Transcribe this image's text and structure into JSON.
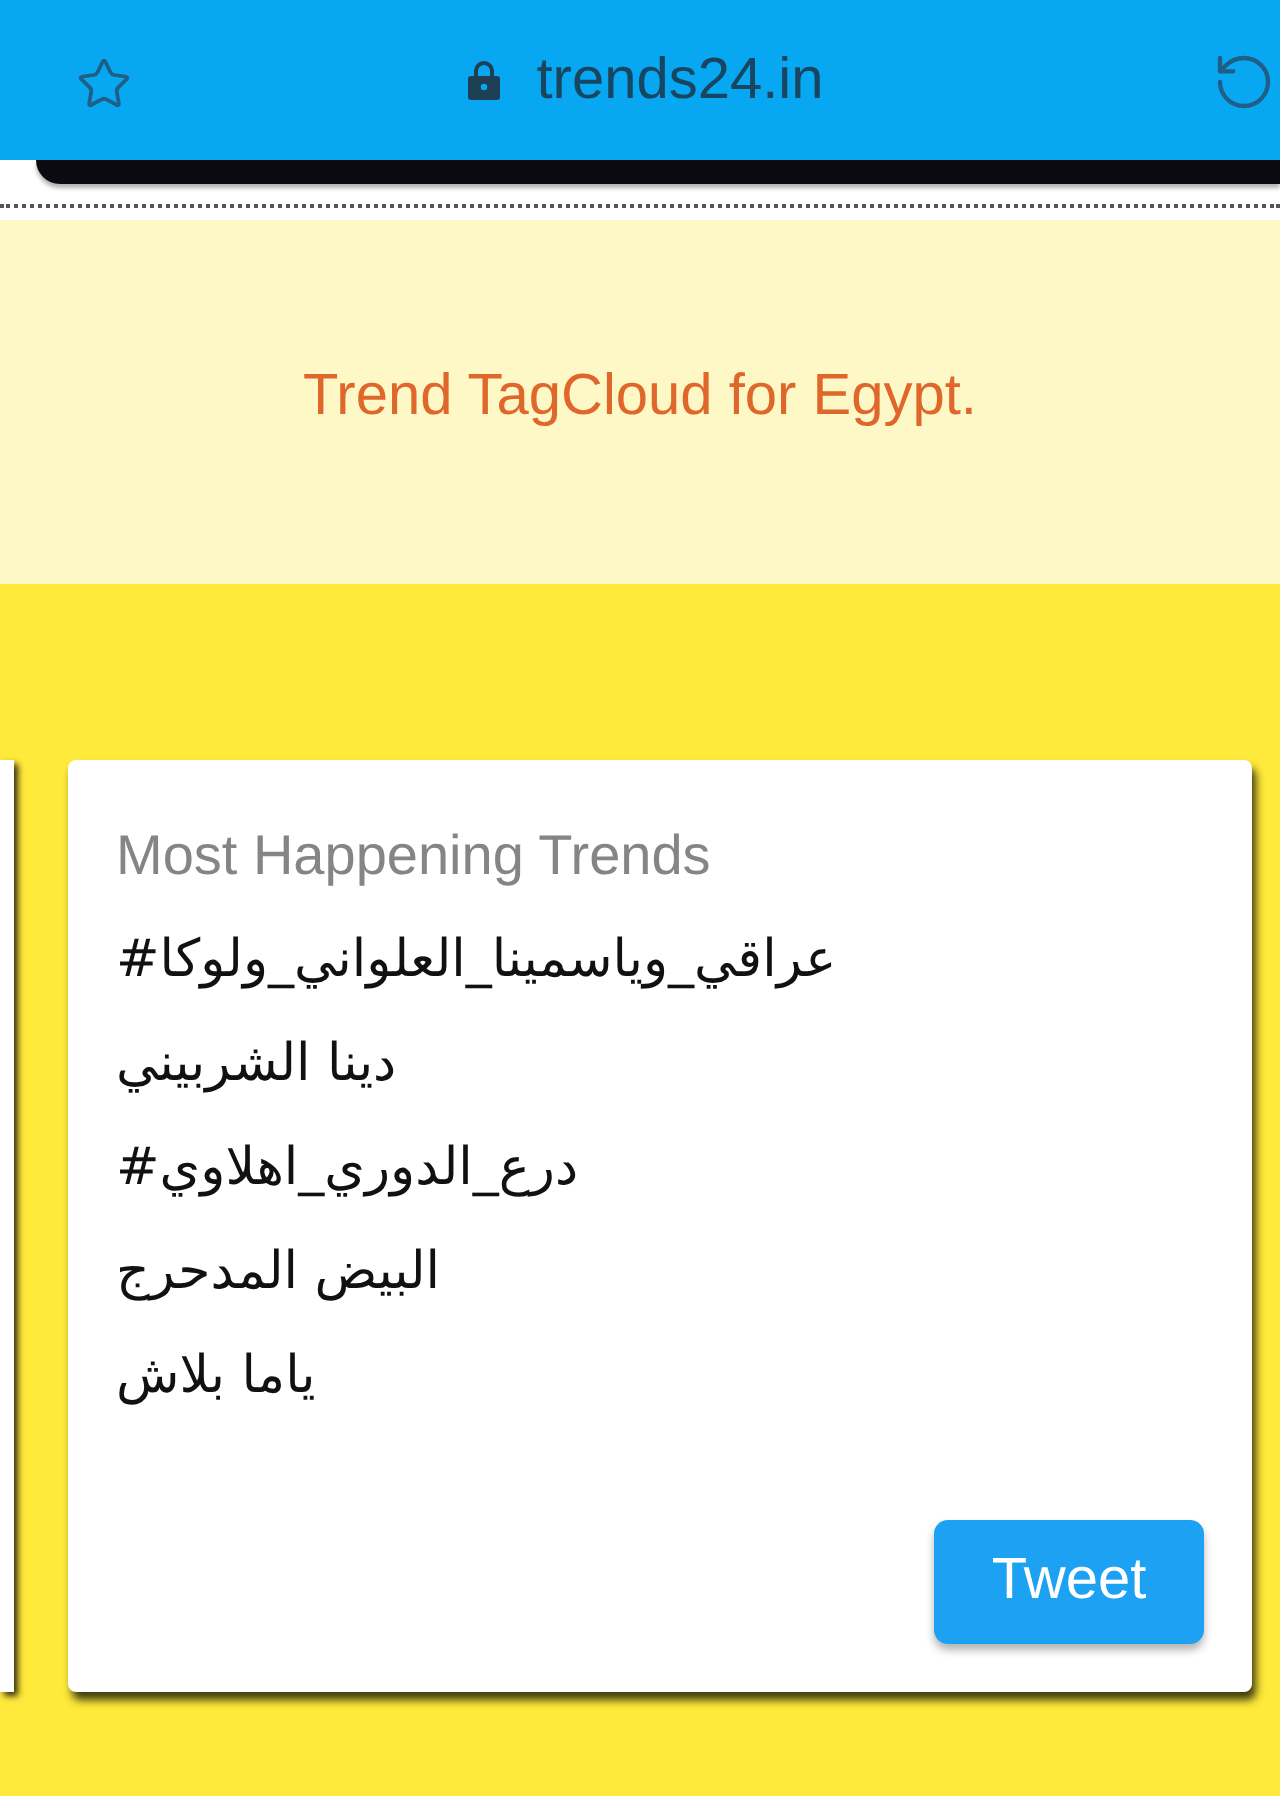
{
  "browser": {
    "url": "trends24.in",
    "secure": true
  },
  "banner": {
    "title": "Trend TagCloud for Egypt."
  },
  "card": {
    "title": "Most Happening Trends",
    "trends": [
      "#عراقي_وياسمينا_العلواني_ولوكا",
      "دينا الشربيني",
      "#درع_الدوري_اهلاوي",
      "البيض المدحرج",
      "ياما بلاش"
    ],
    "button": "Tweet"
  }
}
